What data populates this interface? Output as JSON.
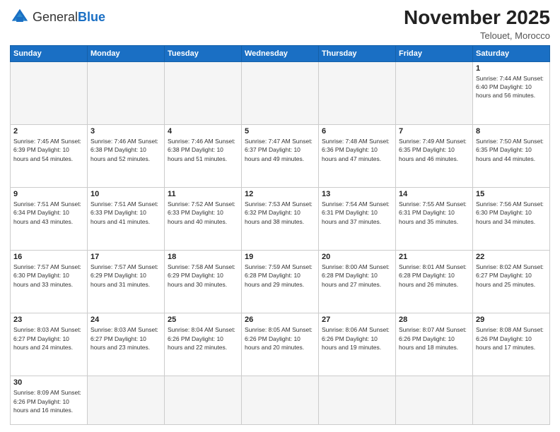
{
  "header": {
    "logo_general": "General",
    "logo_blue": "Blue",
    "month_title": "November 2025",
    "location": "Telouet, Morocco"
  },
  "weekdays": [
    "Sunday",
    "Monday",
    "Tuesday",
    "Wednesday",
    "Thursday",
    "Friday",
    "Saturday"
  ],
  "weeks": [
    [
      {
        "day": "",
        "info": ""
      },
      {
        "day": "",
        "info": ""
      },
      {
        "day": "",
        "info": ""
      },
      {
        "day": "",
        "info": ""
      },
      {
        "day": "",
        "info": ""
      },
      {
        "day": "",
        "info": ""
      },
      {
        "day": "1",
        "info": "Sunrise: 7:44 AM\nSunset: 6:40 PM\nDaylight: 10 hours and 56 minutes."
      }
    ],
    [
      {
        "day": "2",
        "info": "Sunrise: 7:45 AM\nSunset: 6:39 PM\nDaylight: 10 hours and 54 minutes."
      },
      {
        "day": "3",
        "info": "Sunrise: 7:46 AM\nSunset: 6:38 PM\nDaylight: 10 hours and 52 minutes."
      },
      {
        "day": "4",
        "info": "Sunrise: 7:46 AM\nSunset: 6:38 PM\nDaylight: 10 hours and 51 minutes."
      },
      {
        "day": "5",
        "info": "Sunrise: 7:47 AM\nSunset: 6:37 PM\nDaylight: 10 hours and 49 minutes."
      },
      {
        "day": "6",
        "info": "Sunrise: 7:48 AM\nSunset: 6:36 PM\nDaylight: 10 hours and 47 minutes."
      },
      {
        "day": "7",
        "info": "Sunrise: 7:49 AM\nSunset: 6:35 PM\nDaylight: 10 hours and 46 minutes."
      },
      {
        "day": "8",
        "info": "Sunrise: 7:50 AM\nSunset: 6:35 PM\nDaylight: 10 hours and 44 minutes."
      }
    ],
    [
      {
        "day": "9",
        "info": "Sunrise: 7:51 AM\nSunset: 6:34 PM\nDaylight: 10 hours and 43 minutes."
      },
      {
        "day": "10",
        "info": "Sunrise: 7:51 AM\nSunset: 6:33 PM\nDaylight: 10 hours and 41 minutes."
      },
      {
        "day": "11",
        "info": "Sunrise: 7:52 AM\nSunset: 6:33 PM\nDaylight: 10 hours and 40 minutes."
      },
      {
        "day": "12",
        "info": "Sunrise: 7:53 AM\nSunset: 6:32 PM\nDaylight: 10 hours and 38 minutes."
      },
      {
        "day": "13",
        "info": "Sunrise: 7:54 AM\nSunset: 6:31 PM\nDaylight: 10 hours and 37 minutes."
      },
      {
        "day": "14",
        "info": "Sunrise: 7:55 AM\nSunset: 6:31 PM\nDaylight: 10 hours and 35 minutes."
      },
      {
        "day": "15",
        "info": "Sunrise: 7:56 AM\nSunset: 6:30 PM\nDaylight: 10 hours and 34 minutes."
      }
    ],
    [
      {
        "day": "16",
        "info": "Sunrise: 7:57 AM\nSunset: 6:30 PM\nDaylight: 10 hours and 33 minutes."
      },
      {
        "day": "17",
        "info": "Sunrise: 7:57 AM\nSunset: 6:29 PM\nDaylight: 10 hours and 31 minutes."
      },
      {
        "day": "18",
        "info": "Sunrise: 7:58 AM\nSunset: 6:29 PM\nDaylight: 10 hours and 30 minutes."
      },
      {
        "day": "19",
        "info": "Sunrise: 7:59 AM\nSunset: 6:28 PM\nDaylight: 10 hours and 29 minutes."
      },
      {
        "day": "20",
        "info": "Sunrise: 8:00 AM\nSunset: 6:28 PM\nDaylight: 10 hours and 27 minutes."
      },
      {
        "day": "21",
        "info": "Sunrise: 8:01 AM\nSunset: 6:28 PM\nDaylight: 10 hours and 26 minutes."
      },
      {
        "day": "22",
        "info": "Sunrise: 8:02 AM\nSunset: 6:27 PM\nDaylight: 10 hours and 25 minutes."
      }
    ],
    [
      {
        "day": "23",
        "info": "Sunrise: 8:03 AM\nSunset: 6:27 PM\nDaylight: 10 hours and 24 minutes."
      },
      {
        "day": "24",
        "info": "Sunrise: 8:03 AM\nSunset: 6:27 PM\nDaylight: 10 hours and 23 minutes."
      },
      {
        "day": "25",
        "info": "Sunrise: 8:04 AM\nSunset: 6:26 PM\nDaylight: 10 hours and 22 minutes."
      },
      {
        "day": "26",
        "info": "Sunrise: 8:05 AM\nSunset: 6:26 PM\nDaylight: 10 hours and 20 minutes."
      },
      {
        "day": "27",
        "info": "Sunrise: 8:06 AM\nSunset: 6:26 PM\nDaylight: 10 hours and 19 minutes."
      },
      {
        "day": "28",
        "info": "Sunrise: 8:07 AM\nSunset: 6:26 PM\nDaylight: 10 hours and 18 minutes."
      },
      {
        "day": "29",
        "info": "Sunrise: 8:08 AM\nSunset: 6:26 PM\nDaylight: 10 hours and 17 minutes."
      }
    ],
    [
      {
        "day": "30",
        "info": "Sunrise: 8:09 AM\nSunset: 6:26 PM\nDaylight: 10 hours and 16 minutes."
      },
      {
        "day": "",
        "info": ""
      },
      {
        "day": "",
        "info": ""
      },
      {
        "day": "",
        "info": ""
      },
      {
        "day": "",
        "info": ""
      },
      {
        "day": "",
        "info": ""
      },
      {
        "day": "",
        "info": ""
      }
    ]
  ]
}
